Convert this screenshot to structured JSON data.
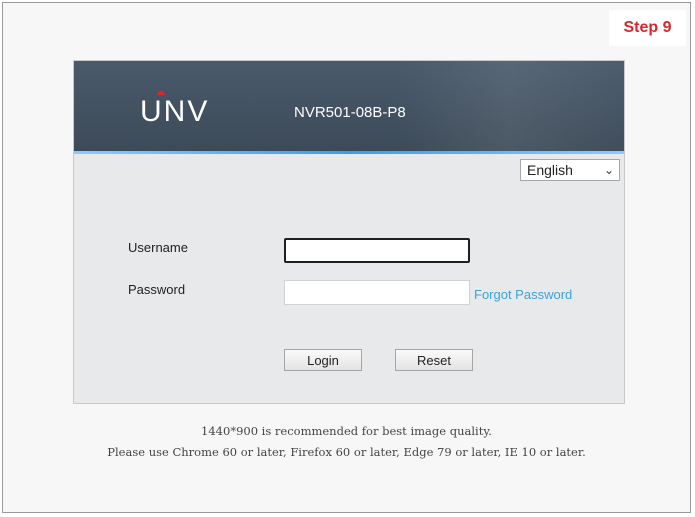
{
  "step_badge": "Step 9",
  "header": {
    "logo": "UNV",
    "model": "NVR501-08B-P8"
  },
  "language": {
    "selected": "English"
  },
  "form": {
    "username_label": "Username",
    "password_label": "Password",
    "username_value": "",
    "password_value": "",
    "forgot_password": "Forgot Password",
    "login_button": "Login",
    "reset_button": "Reset"
  },
  "notes": {
    "line1": "1440*900 is recommended for best image quality.",
    "line2": "Please use Chrome 60 or later, Firefox 60 or later, Edge 79 or later, IE 10 or later."
  },
  "colors": {
    "header_bg": "#3c4a58",
    "accent_blue": "#3aa3dc",
    "brand_red": "#e0252a",
    "step_red": "#d9262b"
  }
}
